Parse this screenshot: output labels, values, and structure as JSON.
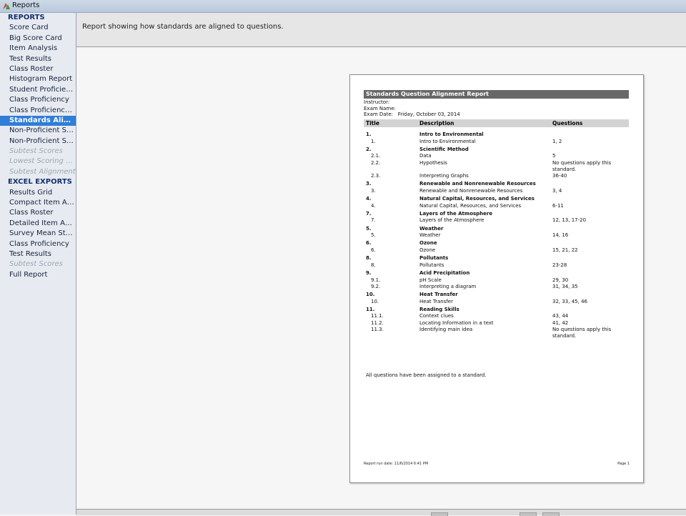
{
  "window": {
    "title": "Reports"
  },
  "sidebar": {
    "sections": [
      {
        "label": "REPORTS",
        "items": [
          {
            "label": "Score Card",
            "state": "normal"
          },
          {
            "label": "Big Score Card",
            "state": "normal"
          },
          {
            "label": "Item Analysis",
            "state": "normal"
          },
          {
            "label": "Test Results",
            "state": "normal"
          },
          {
            "label": "Class Roster",
            "state": "normal"
          },
          {
            "label": "Histogram Report",
            "state": "normal"
          },
          {
            "label": "Student Proficiency",
            "state": "normal"
          },
          {
            "label": "Class Proficiency",
            "state": "normal"
          },
          {
            "label": "Class Proficiency Ite...",
            "state": "normal"
          },
          {
            "label": "Standards Alignm...",
            "state": "selected"
          },
          {
            "label": "Non-Proficient Stud...",
            "state": "normal"
          },
          {
            "label": "Non-Proficient Stud...",
            "state": "normal"
          },
          {
            "label": "Subtest Scores",
            "state": "disabled"
          },
          {
            "label": "Lowest Scoring Stud...",
            "state": "disabled"
          },
          {
            "label": "Subtest Alignment",
            "state": "disabled"
          }
        ]
      },
      {
        "label": "EXCEL EXPORTS",
        "items": [
          {
            "label": "Results Grid",
            "state": "normal"
          },
          {
            "label": "Compact Item Anal...",
            "state": "normal"
          },
          {
            "label": "Class Roster",
            "state": "normal"
          },
          {
            "label": "Detailed Item Analy...",
            "state": "normal"
          },
          {
            "label": "Survey Mean Statistic",
            "state": "normal"
          },
          {
            "label": "Class Proficiency",
            "state": "normal"
          },
          {
            "label": "Test Results",
            "state": "normal"
          },
          {
            "label": "Subtest Scores",
            "state": "disabled"
          },
          {
            "label": "Full Report",
            "state": "normal"
          }
        ]
      }
    ]
  },
  "header": {
    "description": "Report showing how standards are aligned to questions."
  },
  "report": {
    "title": "Standards Question Alignment Report",
    "instructor_label": "Instructor:",
    "exam_name_label": "Exam Name:",
    "exam_date_label": "Exam Date:",
    "exam_date": "Friday, October 03, 2014",
    "columns": {
      "title": "Title",
      "description": "Description",
      "questions": "Questions"
    },
    "standards": [
      {
        "num": "1.",
        "name": "Intro to Environmental",
        "subs": [
          {
            "num": "1.",
            "desc": "Intro to Environmental",
            "q": "1, 2"
          }
        ]
      },
      {
        "num": "2.",
        "name": "Scientific Method",
        "subs": [
          {
            "num": "2.1.",
            "desc": "Data",
            "q": "5"
          },
          {
            "num": "2.2.",
            "desc": "Hypothesis",
            "q": "No questions apply this standard."
          },
          {
            "num": "2.3.",
            "desc": "Interpreting Graphs",
            "q": "36-40"
          }
        ]
      },
      {
        "num": "3.",
        "name": "Renewable and Nonrenewable Resources",
        "subs": [
          {
            "num": "3.",
            "desc": "Renewable and Nonrenewable Resources",
            "q": "3, 4"
          }
        ]
      },
      {
        "num": "4.",
        "name": "Natural Capital, Resources, and Services",
        "subs": [
          {
            "num": "4.",
            "desc": "Natural Capital, Resources, and Services",
            "q": "6-11"
          }
        ]
      },
      {
        "num": "7.",
        "name": "Layers of the Atmosphere",
        "subs": [
          {
            "num": "7.",
            "desc": "Layers of the Atmosphere",
            "q": "12, 13, 17-20"
          }
        ]
      },
      {
        "num": "5.",
        "name": "Weather",
        "subs": [
          {
            "num": "5.",
            "desc": "Weather",
            "q": "14, 16"
          }
        ]
      },
      {
        "num": "6.",
        "name": "Ozone",
        "subs": [
          {
            "num": "6.",
            "desc": "Ozone",
            "q": "15, 21, 22"
          }
        ]
      },
      {
        "num": "8.",
        "name": "Pollutants",
        "subs": [
          {
            "num": "8.",
            "desc": "Pollutants",
            "q": "23-28"
          }
        ]
      },
      {
        "num": "9.",
        "name": "Acid Precipitation",
        "subs": [
          {
            "num": "9.1.",
            "desc": "pH Scale",
            "q": "29, 30"
          },
          {
            "num": "9.2.",
            "desc": "Interpreting a diagram",
            "q": "31, 34, 35"
          }
        ]
      },
      {
        "num": "10.",
        "name": "Heat Transfer",
        "subs": [
          {
            "num": "10.",
            "desc": "Heat Transfer",
            "q": "32, 33, 45, 46"
          }
        ]
      },
      {
        "num": "11.",
        "name": "Reading Skills",
        "subs": [
          {
            "num": "11.1.",
            "desc": "Context clues",
            "q": "43, 44"
          },
          {
            "num": "11.2.",
            "desc": "Locating Information in a text",
            "q": "41, 42"
          },
          {
            "num": "11.3.",
            "desc": "Identifying main idea",
            "q": "No questions apply this standard."
          }
        ]
      }
    ],
    "footer_note": "All questions have been assigned to a standard.",
    "run_date_label": "Report run date:",
    "run_date": "11/6/2014 6:41 PM",
    "page_label": "Page 1"
  },
  "colors": {
    "selected": "#2f7ed8",
    "report_bar": "#686868",
    "table_header": "#d3d3d3"
  }
}
